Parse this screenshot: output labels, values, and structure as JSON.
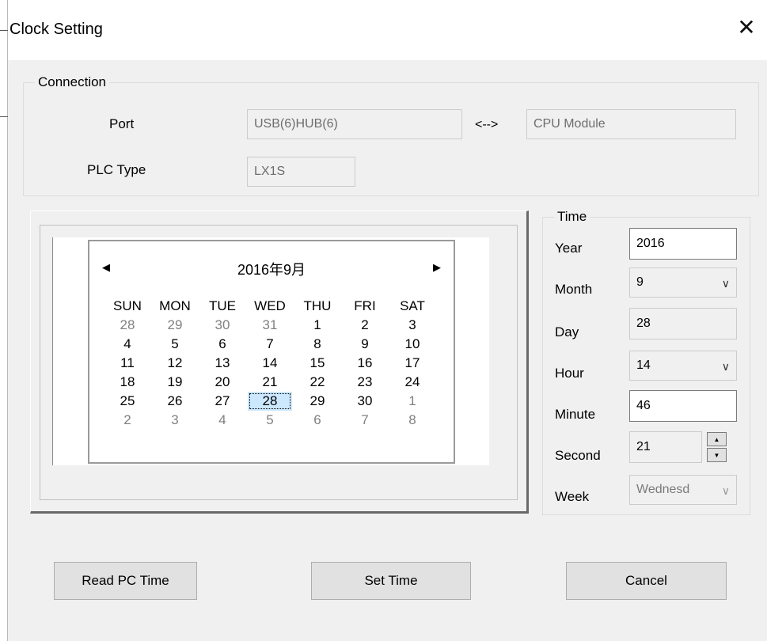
{
  "window": {
    "title": "Clock Setting",
    "close_glyph": "✕"
  },
  "connection": {
    "legend": "Connection",
    "port_label": "Port",
    "port_value": "USB(6)HUB(6)",
    "arrow_text": "<-->",
    "target_value": "CPU Module",
    "plc_type_label": "PLC Type",
    "plc_type_value": "LX1S"
  },
  "calendar": {
    "title": "2016年9月",
    "prev_glyph": "◀",
    "next_glyph": "▶",
    "weekdays": [
      "SUN",
      "MON",
      "TUE",
      "WED",
      "THU",
      "FRI",
      "SAT"
    ],
    "weeks": [
      [
        "28",
        "29",
        "30",
        "31",
        "1",
        "2",
        "3"
      ],
      [
        "4",
        "5",
        "6",
        "7",
        "8",
        "9",
        "10"
      ],
      [
        "11",
        "12",
        "13",
        "14",
        "15",
        "16",
        "17"
      ],
      [
        "18",
        "19",
        "20",
        "21",
        "22",
        "23",
        "24"
      ],
      [
        "25",
        "26",
        "27",
        "28",
        "29",
        "30",
        "1"
      ],
      [
        "2",
        "3",
        "4",
        "5",
        "6",
        "7",
        "8"
      ]
    ],
    "other_month": [
      [
        true,
        true,
        true,
        true,
        false,
        false,
        false
      ],
      [
        false,
        false,
        false,
        false,
        false,
        false,
        false
      ],
      [
        false,
        false,
        false,
        false,
        false,
        false,
        false
      ],
      [
        false,
        false,
        false,
        false,
        false,
        false,
        false
      ],
      [
        false,
        false,
        false,
        false,
        false,
        false,
        true
      ],
      [
        true,
        true,
        true,
        true,
        true,
        true,
        true
      ]
    ],
    "selected": {
      "week": 4,
      "day": 3
    }
  },
  "time": {
    "legend": "Time",
    "year_label": "Year",
    "year_value": "2016",
    "month_label": "Month",
    "month_value": "9",
    "day_label": "Day",
    "day_value": "28",
    "hour_label": "Hour",
    "hour_value": "14",
    "minute_label": "Minute",
    "minute_value": "46",
    "second_label": "Second",
    "second_value": "21",
    "week_label": "Week",
    "week_value": "Wednesd"
  },
  "buttons": {
    "read_pc_time": "Read PC Time",
    "set_time": "Set Time",
    "cancel": "Cancel"
  },
  "icons": {
    "dropdown": "chevron-down-icon",
    "close": "close-icon",
    "spin_up": "▲",
    "spin_down": "▼",
    "chevron": "∨"
  }
}
